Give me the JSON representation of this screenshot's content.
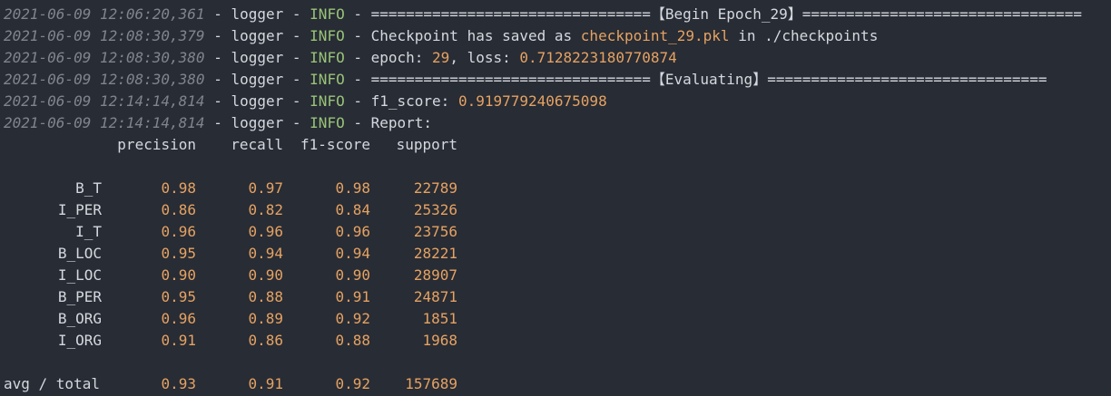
{
  "logs": [
    {
      "ts": "2021-06-09 12:06:20,361",
      "logger": "logger",
      "level": "INFO",
      "pre": "================================",
      "bracket": "【Begin Epoch_29】",
      "post": "================================"
    },
    {
      "ts": "2021-06-09 12:08:30,379",
      "logger": "logger",
      "level": "INFO",
      "pre_text": "Checkpoint has saved as ",
      "file": "checkpoint_29.pkl",
      "post_text": " in ./checkpoints"
    },
    {
      "ts": "2021-06-09 12:08:30,380",
      "logger": "logger",
      "level": "INFO",
      "epoch_label": "epoch: ",
      "epoch": "29",
      "loss_label": ", loss: ",
      "loss": "0.7128223180770874"
    },
    {
      "ts": "2021-06-09 12:08:30,380",
      "logger": "logger",
      "level": "INFO",
      "pre": "================================",
      "bracket": "【Evaluating】",
      "post": "================================"
    },
    {
      "ts": "2021-06-09 12:14:14,814",
      "logger": "logger",
      "level": "INFO",
      "f1_label": "f1_score: ",
      "f1": "0.919779240675098"
    },
    {
      "ts": "2021-06-09 12:14:14,814",
      "logger": "logger",
      "level": "INFO",
      "report_label": "Report:"
    }
  ],
  "sep": " - ",
  "report": {
    "headers": [
      "",
      "precision",
      "recall",
      "f1-score",
      "support"
    ],
    "rows": [
      [
        "B_T",
        "0.98",
        "0.97",
        "0.98",
        "22789"
      ],
      [
        "I_PER",
        "0.86",
        "0.82",
        "0.84",
        "25326"
      ],
      [
        "I_T",
        "0.96",
        "0.96",
        "0.96",
        "23756"
      ],
      [
        "B_LOC",
        "0.95",
        "0.94",
        "0.94",
        "28221"
      ],
      [
        "I_LOC",
        "0.90",
        "0.90",
        "0.90",
        "28907"
      ],
      [
        "B_PER",
        "0.95",
        "0.88",
        "0.91",
        "24871"
      ],
      [
        "B_ORG",
        "0.96",
        "0.89",
        "0.92",
        "1851"
      ],
      [
        "I_ORG",
        "0.91",
        "0.86",
        "0.88",
        "1968"
      ]
    ],
    "total": [
      "avg / total",
      "0.93",
      "0.91",
      "0.92",
      "157689"
    ]
  },
  "colors": {
    "background": "#282c34",
    "text": "#d5d8de",
    "timestamp": "#7f848e",
    "info": "#98c379",
    "number": "#e5a263"
  }
}
